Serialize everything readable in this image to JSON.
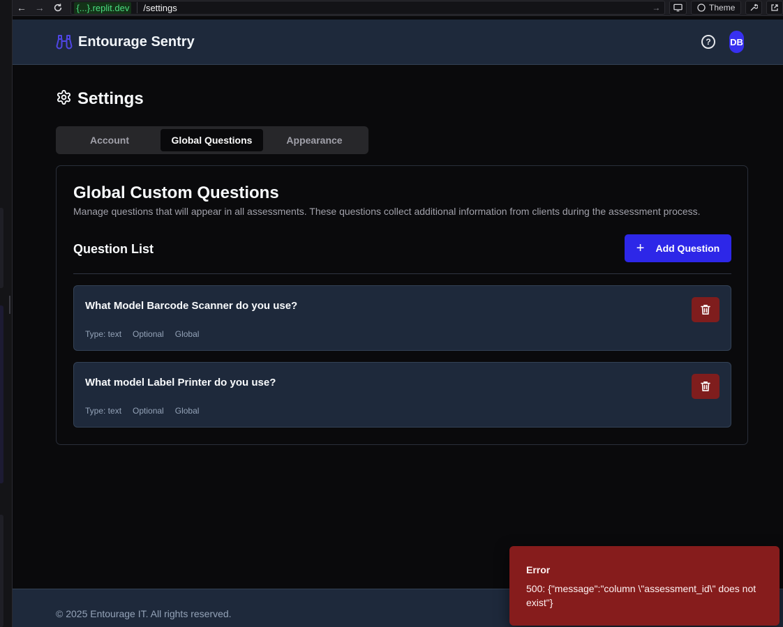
{
  "browser": {
    "domain_prefix": "{...}",
    "domain_suffix": ".replit.dev",
    "path": "/settings",
    "theme_label": "Theme"
  },
  "app": {
    "name": "Entourage Sentry",
    "avatar_initials": "DB"
  },
  "page": {
    "title": "Settings",
    "tabs": [
      {
        "label": "Account"
      },
      {
        "label": "Global Questions"
      },
      {
        "label": "Appearance"
      }
    ],
    "active_tab": "Global Questions"
  },
  "card": {
    "title": "Global Custom Questions",
    "description": "Manage questions that will appear in all assessments. These questions collect additional information from clients during the assessment process.",
    "list_title": "Question List",
    "add_button_label": "Add Question",
    "questions": [
      {
        "text": "What Model Barcode Scanner do you use?",
        "type": "Type: text",
        "required": "Optional",
        "scope": "Global"
      },
      {
        "text": "What model Label Printer do you use?",
        "type": "Type: text",
        "required": "Optional",
        "scope": "Global"
      }
    ]
  },
  "footer": {
    "copyright": "© 2025 Entourage IT. All rights reserved."
  },
  "toast": {
    "title": "Error",
    "message": "500: {\"message\":\"column \\\"assessment_id\\\" does not exist\"}"
  },
  "colors": {
    "brand_accent": "#3730f0",
    "header_bg": "#1e293b",
    "danger": "#7f1d1d",
    "toast_bg": "#861c1c"
  }
}
